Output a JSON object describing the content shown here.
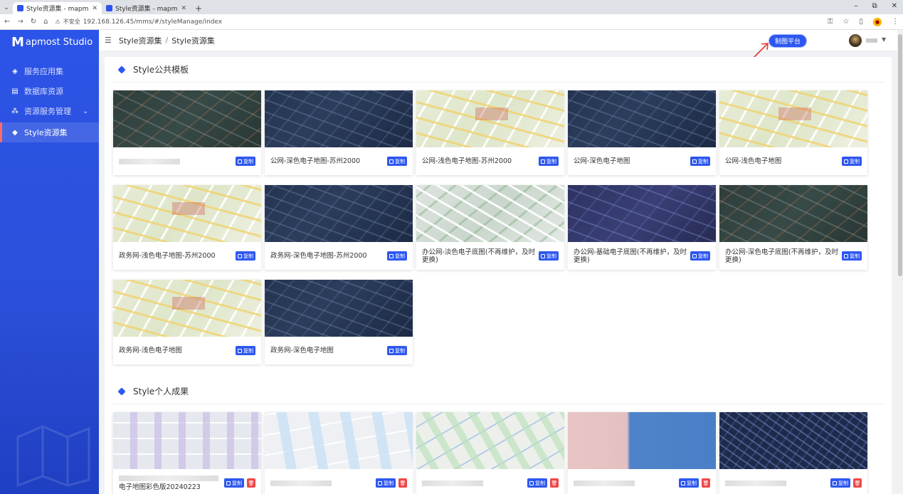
{
  "browser": {
    "tabs": [
      {
        "title": "Style资源集 - mapmost studio"
      },
      {
        "title": "Style资源集 - mapmost studio"
      }
    ],
    "url_warning": "不安全",
    "url": "192.168.126.45/mms/#/styleManage/index"
  },
  "sidebar": {
    "logo": "apmost Studio",
    "logo_mark": "M",
    "items": [
      {
        "label": "服务应用集",
        "icon": "layers-icon"
      },
      {
        "label": "数据库资源",
        "icon": "database-icon"
      },
      {
        "label": "资源服务管理",
        "icon": "cluster-icon",
        "has_children": true
      },
      {
        "label": "Style资源集",
        "icon": "style-icon",
        "active": true
      }
    ]
  },
  "header": {
    "breadcrumb": [
      "Style资源集",
      "Style资源集"
    ],
    "platform_button": "制图平台"
  },
  "sections": {
    "public": {
      "title": "Style公共模板",
      "cards": [
        {
          "name": "",
          "theme": "darkgreen"
        },
        {
          "name": "公网-深色电子地图-苏州2000",
          "theme": "dark"
        },
        {
          "name": "公网-浅色电子地图-苏州2000",
          "theme": "light"
        },
        {
          "name": "公网-深色电子地图",
          "theme": "dark"
        },
        {
          "name": "公网-浅色电子地图",
          "theme": "light"
        },
        {
          "name": "政务网-浅色电子地图-苏州2000",
          "theme": "light"
        },
        {
          "name": "政务网-深色电子地图-苏州2000",
          "theme": "dark"
        },
        {
          "name": "办公网-淡色电子底图(不再维护，及时更换)",
          "theme": "lightgray"
        },
        {
          "name": "办公网-基础电子底图(不再维护，及时更换)",
          "theme": "purple"
        },
        {
          "name": "办公网-深色电子底图(不再维护，及时更换)",
          "theme": "darkgreen"
        },
        {
          "name": "政务网-浅色电子地图",
          "theme": "light"
        },
        {
          "name": "政务网-深色电子地图",
          "theme": "dark"
        }
      ]
    },
    "personal": {
      "title": "Style个人成果",
      "cards": [
        {
          "name": "电子地图彩色版20240223",
          "theme": "map1"
        },
        {
          "name": "",
          "theme": "map2"
        },
        {
          "name": "",
          "theme": "map3"
        },
        {
          "name": "",
          "theme": "map4"
        },
        {
          "name": "",
          "theme": "map5"
        }
      ]
    }
  },
  "labels": {
    "copy": "复制",
    "delete": "删除"
  }
}
